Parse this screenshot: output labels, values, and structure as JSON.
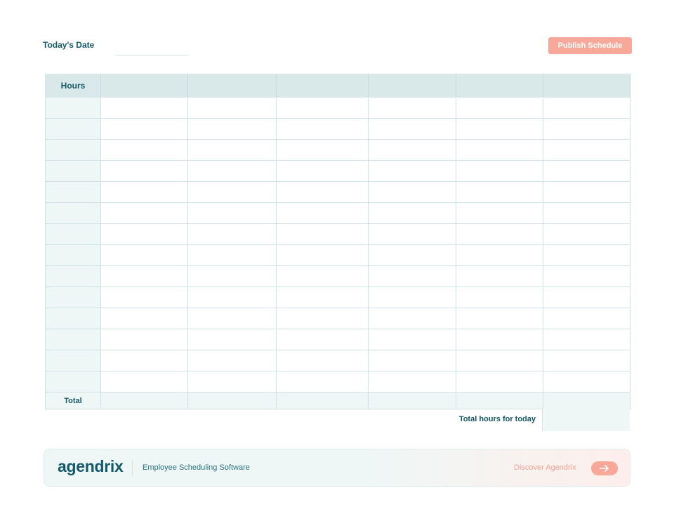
{
  "header": {
    "date_label": "Today's Date",
    "date_value": "",
    "publish_label": "Publish Schedule"
  },
  "table": {
    "hours_header": "Hours",
    "column_headers": [
      "",
      "",
      "",
      "",
      "",
      ""
    ],
    "total_label": "Total",
    "summary_label": "Total hours for today",
    "summary_value": ""
  },
  "banner": {
    "brand": "agendrix",
    "tagline": "Employee Scheduling Software",
    "cta_label": "Discover Agendrix",
    "cta_icon": "arrow-right-icon"
  },
  "colors": {
    "brand_teal": "#15596b",
    "accent_salmon": "#f7a898",
    "header_fill": "#d9e8e8",
    "grid_line": "#cfe3e4",
    "light_fill": "#eef7f6"
  }
}
